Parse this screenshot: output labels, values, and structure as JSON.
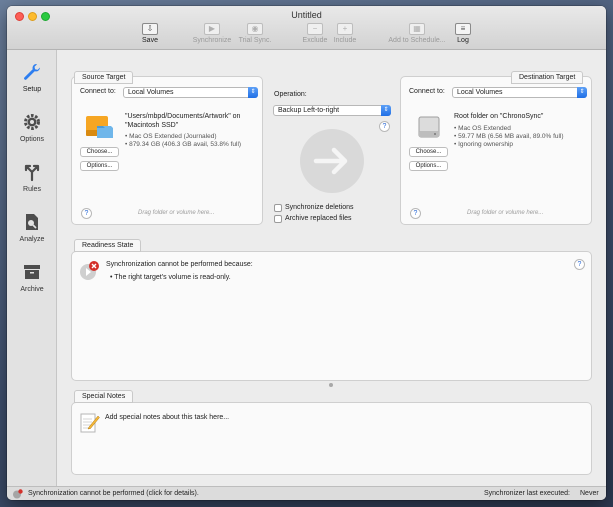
{
  "window": {
    "title": "Untitled"
  },
  "toolbar": {
    "save": "Save",
    "synchronize": "Synchronize",
    "trial_sync": "Trial Sync.",
    "exclude": "Exclude",
    "include": "Include",
    "add_to_schedule": "Add to Schedule...",
    "log": "Log"
  },
  "sidebar": {
    "setup": "Setup",
    "options": "Options",
    "rules": "Rules",
    "analyze": "Analyze",
    "archive": "Archive"
  },
  "source": {
    "tab": "Source Target",
    "connect_label": "Connect to:",
    "connect_value": "Local Volumes",
    "path_line1": "\"Users/mbpd/Documents/Artwork\" on",
    "path_line2": "\"Macintosh SSD\"",
    "detail1": "• Mac OS Extended (Journaled)",
    "detail2": "• 879.34 GB (406.3 GB avail, 53.8% full)",
    "choose": "Choose...",
    "options": "Options...",
    "hint": "Drag folder or volume here...",
    "help": "?"
  },
  "operation": {
    "label": "Operation:",
    "value": "Backup Left-to-right",
    "help": "?",
    "sync_deletions": "Synchronize deletions",
    "archive_replaced": "Archive replaced files"
  },
  "destination": {
    "tab": "Destination Target",
    "connect_label": "Connect to:",
    "connect_value": "Local Volumes",
    "path_line1": "Root folder on \"ChronoSync\"",
    "detail1": "• Mac OS Extended",
    "detail2": "• 59.77 MB (6.56 MB avail, 89.0% full)",
    "detail3": "• Ignoring ownership",
    "choose": "Choose...",
    "options": "Options...",
    "hint": "Drag folder or volume here...",
    "help": "?"
  },
  "readiness": {
    "tab": "Readiness State",
    "heading": "Synchronization cannot be performed because:",
    "reason": "• The right target's volume is read-only.",
    "help": "?"
  },
  "notes": {
    "tab": "Special Notes",
    "placeholder": "Add special notes about this task here..."
  },
  "statusbar": {
    "message": "Synchronization cannot be performed (click for details).",
    "last_executed_label": "Synchronizer last executed:",
    "last_executed_value": "Never"
  },
  "colors": {
    "accent": "#2d7ef0",
    "error": "#d3302a"
  }
}
